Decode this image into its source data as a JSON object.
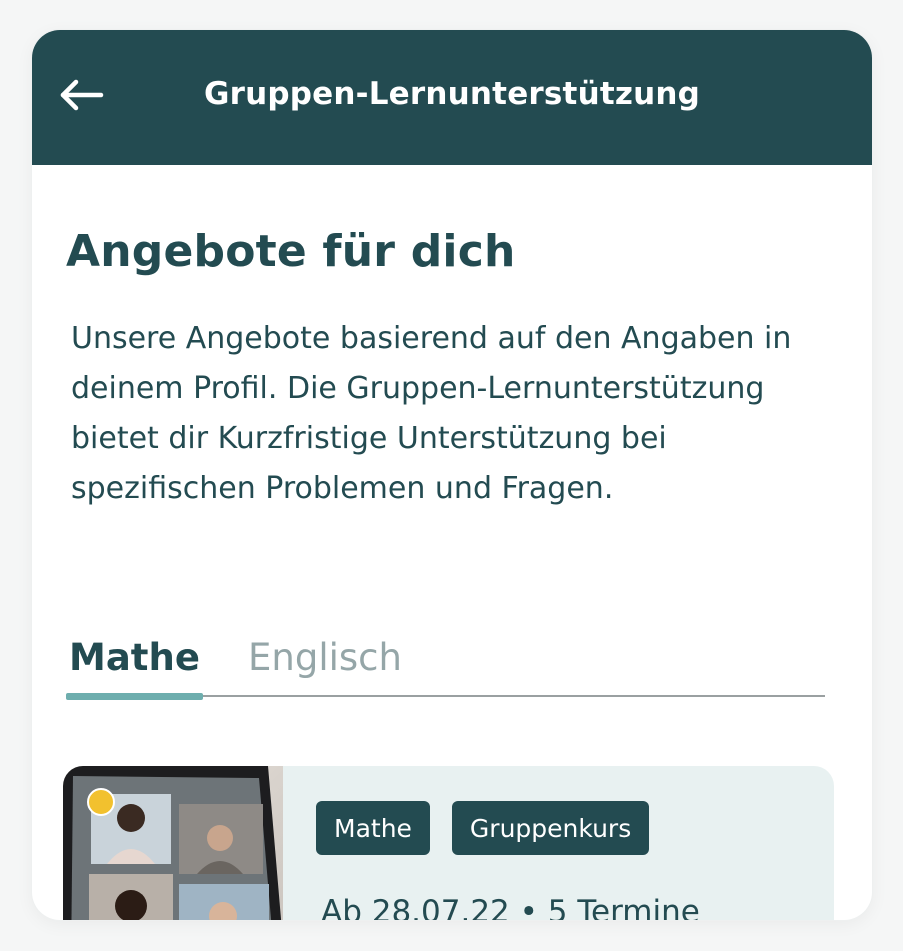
{
  "header": {
    "title": "Gruppen-Lernunterstützung",
    "back_icon": "arrow-left-icon"
  },
  "main": {
    "heading": "Angebote für dich",
    "description": "Unsere Angebote basierend auf den Angaben in deinem Profil. Die Gruppen-Lernunterstützung bietet dir Kurzfristige Unterstützung bei spezifischen Problemen und Fragen.",
    "tabs": [
      {
        "label": "Mathe",
        "active": true
      },
      {
        "label": "Englisch",
        "active": false
      }
    ]
  },
  "card": {
    "tags": [
      "Mathe",
      "Gruppenkurs"
    ],
    "meta": "Ab 28.07.22 • 5 Termine"
  },
  "colors": {
    "primary": "#234b51",
    "accent": "#6eaeae",
    "card_bg": "#e8f1f1",
    "status_dot": "#f2c12e"
  }
}
